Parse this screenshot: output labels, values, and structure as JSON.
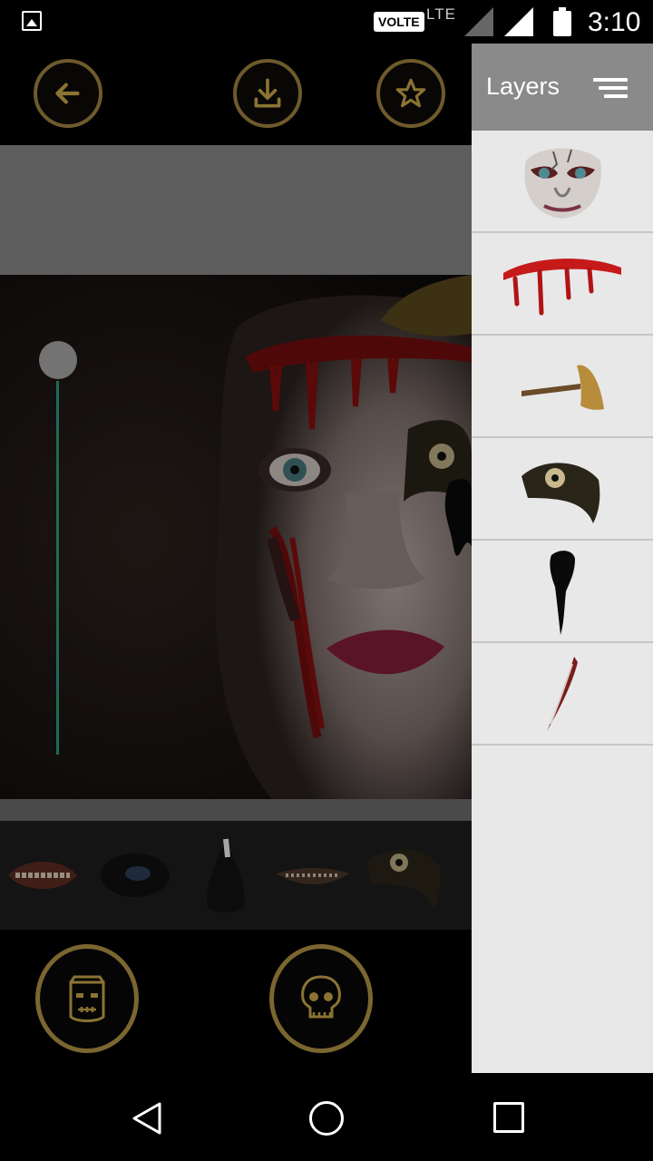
{
  "status_bar": {
    "volte": "VOLTE",
    "network": "LTE",
    "time": "3:10"
  },
  "toolbar": {
    "back_icon": "arrow-left-icon",
    "download_icon": "download-icon",
    "favorite_icon": "star-icon",
    "accent_color": "#6e5a2c"
  },
  "layers_panel": {
    "title": "Layers",
    "sort_icon": "sort-lines-icon",
    "items": [
      {
        "name": "zombie-face"
      },
      {
        "name": "blood-forehead"
      },
      {
        "name": "axe"
      },
      {
        "name": "dark-eye"
      },
      {
        "name": "black-drip"
      },
      {
        "name": "scar-wound"
      }
    ]
  },
  "sticker_strip": {
    "items": [
      {
        "name": "teeth-mouth"
      },
      {
        "name": "dark-eye"
      },
      {
        "name": "nose"
      },
      {
        "name": "stitched-mouth"
      },
      {
        "name": "dark-eye-2"
      }
    ]
  },
  "bottom_tools": [
    {
      "icon": "frankenstein-icon"
    },
    {
      "icon": "skull-icon"
    }
  ],
  "opacity_slider": {
    "value": 1.0
  },
  "navigation": {
    "back": "back-triangle-icon",
    "home": "home-circle-icon",
    "recent": "recent-square-icon"
  }
}
